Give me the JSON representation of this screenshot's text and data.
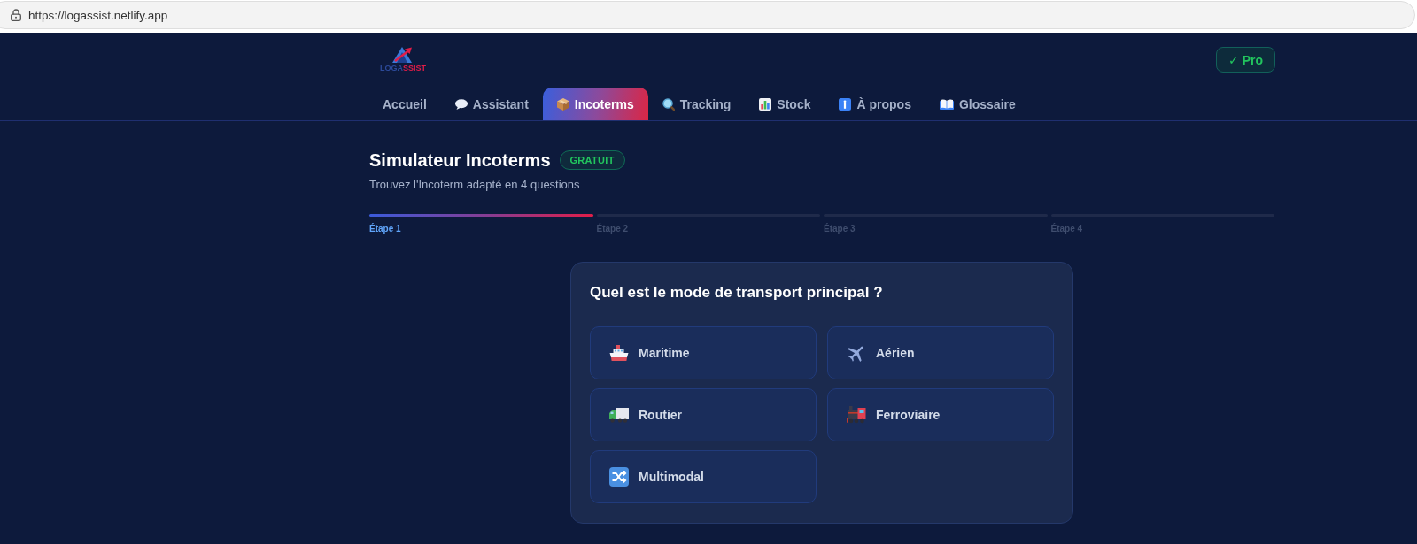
{
  "browser": {
    "url": "https://logassist.netlify.app"
  },
  "header": {
    "logo": {
      "wordmark": [
        {
          "text": "LOGA",
          "color": "#2c4a9a"
        },
        {
          "text": "SSIST",
          "color": "#e11d48"
        }
      ]
    },
    "plan_badge": "✓ Pro"
  },
  "nav": {
    "tabs": [
      {
        "label": "Accueil",
        "selected": false
      },
      {
        "label": "Assistant",
        "selected": false
      },
      {
        "label": "Incoterms",
        "selected": true
      },
      {
        "label": "Tracking",
        "selected": false
      },
      {
        "label": "Stock",
        "selected": false
      },
      {
        "label": "À propos",
        "selected": false
      },
      {
        "label": "Glossaire",
        "selected": false
      }
    ]
  },
  "simulator": {
    "title": "Simulateur Incoterms",
    "badge": "GRATUIT",
    "subtitle": "Trouvez l'Incoterm adapté en 4 questions",
    "steps": [
      {
        "label": "Étape 1",
        "selected": true
      },
      {
        "label": "Étape 2",
        "selected": false
      },
      {
        "label": "Étape 3",
        "selected": false
      },
      {
        "label": "Étape 4",
        "selected": false
      }
    ],
    "question": {
      "title": "Quel est le mode de transport principal ?",
      "options": [
        {
          "label": "Maritime",
          "selected": false
        },
        {
          "label": "Aérien",
          "selected": false
        },
        {
          "label": "Routier",
          "selected": false
        },
        {
          "label": "Ferroviaire",
          "selected": false
        },
        {
          "label": "Multimodal",
          "selected": false
        }
      ]
    }
  }
}
